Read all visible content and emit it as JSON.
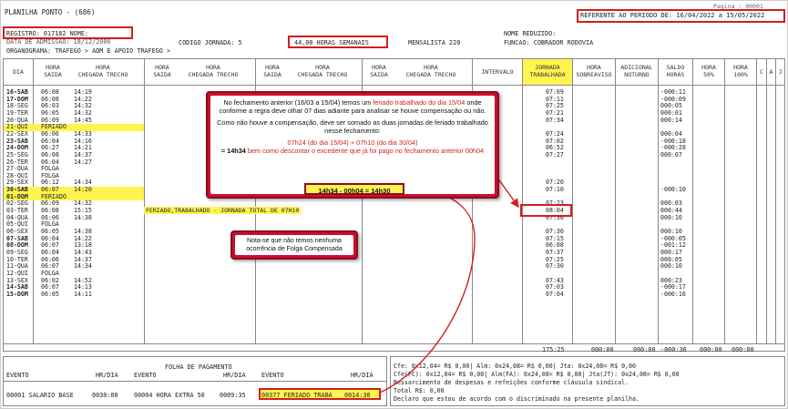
{
  "header": {
    "title": "PLANILHA PONTO - (686)",
    "pagina": "Pagina :  00001",
    "periodo": "REFERENTE AO PERIODO DE: 16/04/2022 a 15/05/2022",
    "registro": "REGISTRO: 017182   NOME:",
    "admissao": "DATA DE ADMISSAO:  18/12/2006",
    "codigo_jornada": "CODIGO JORNADA:  5",
    "horas_semanais": "44,00 HORAS SEMANAIS",
    "mensalista": "MENSALISTA     220",
    "nome_reduzido": "NOME REDUZIDO:",
    "funcao": "FUNCAO:  COBRADOR RODOVIA",
    "organograma": "ORGANOGRAMA: TRAFEGO > ADM E APOIO TRAFEGO >"
  },
  "columns": {
    "dia": "DIA",
    "hora_saida": "HORA\nSAIDA",
    "hora_chegada": "HORA\nCHEGADA TRECHO",
    "intervalo": "INTERVALO",
    "jornada": "JORNADA\nTRABALHADA",
    "sobreaviso": "HORA\nSOBREAVISO",
    "noturno": "ADICIONAL\nNOTURNO",
    "saldo": "SALDO\nHORAS",
    "h50": "HORA\n50%",
    "h100": "HORA\n100%",
    "c": "C",
    "a": "A",
    "j": "J"
  },
  "rows": [
    {
      "dia": "16-SAB",
      "s": "06:08",
      "c": "14:19",
      "jt": "07:09",
      "saldo": "-000:11",
      "hl": false
    },
    {
      "dia": "17-DOM",
      "s": "06:08",
      "c": "14:22",
      "jt": "07:11",
      "saldo": "-000:09",
      "hl": false
    },
    {
      "dia": "18-SEG",
      "s": "06:03",
      "c": "14:32",
      "jt": "07:25",
      "saldo": "000:05",
      "hl": false
    },
    {
      "dia": "19-TER",
      "s": "06:05",
      "c": "14:32",
      "jt": "07:21",
      "saldo": "000:01",
      "hl": false
    },
    {
      "dia": "20-QUA",
      "s": "06:09",
      "c": "14:45",
      "jt": "07:34",
      "saldo": "000:14",
      "hl": false
    },
    {
      "dia": "21-QUI",
      "s": "FERIADO",
      "c": "",
      "jt": "",
      "saldo": "",
      "hl": true
    },
    {
      "dia": "22-SEX",
      "s": "06:06",
      "c": "14:33",
      "jt": "07:24",
      "saldo": "000:04",
      "hl": false
    },
    {
      "dia": "23-SAB",
      "s": "06:04",
      "c": "14:16",
      "jt": "07:02",
      "saldo": "-000:18",
      "hl": false
    },
    {
      "dia": "24-DOM",
      "s": "06:27",
      "c": "14:21",
      "jt": "06:52",
      "saldo": "-000:28",
      "hl": false
    },
    {
      "dia": "25-SEG",
      "s": "06:08",
      "c": "14:37",
      "jt": "07:27",
      "saldo": "000:07",
      "hl": false
    },
    {
      "dia": "26-TER",
      "s": "06:04",
      "c": "14:27",
      "jt": "",
      "saldo": "",
      "hl": false
    },
    {
      "dia": "27-QUA",
      "s": "FOLGA",
      "c": "",
      "jt": "",
      "saldo": "",
      "hl": false
    },
    {
      "dia": "28-QUI",
      "s": "FOLGA",
      "c": "",
      "jt": "",
      "saldo": "",
      "hl": false
    },
    {
      "dia": "29-SEX",
      "s": "06:12",
      "c": "14:34",
      "jt": "07:20",
      "saldo": "",
      "hl": false
    },
    {
      "dia": "30-SAB",
      "s": "06:07",
      "c": "14:20",
      "jt": "07:10",
      "saldo": "-000:10",
      "hl": true
    },
    {
      "dia": "01-DOM",
      "s": "FERIADO",
      "c": "",
      "jt": "",
      "saldo": "",
      "hl": true
    },
    {
      "dia": "02-SEG",
      "s": "06:09",
      "c": "14:32",
      "jt": "07:23",
      "saldo": "000:03",
      "hl": false
    },
    {
      "dia": "03-TER",
      "s": "06:08",
      "c": "15:15",
      "jt": "08:04",
      "saldo": "000:44",
      "hl": false
    },
    {
      "dia": "04-QUA",
      "s": "06:06",
      "c": "14:38",
      "jt": "07:30",
      "saldo": "000:10",
      "hl": false
    },
    {
      "dia": "05-QUI",
      "s": "FOLGA",
      "c": "",
      "jt": "",
      "saldo": "",
      "hl": false
    },
    {
      "dia": "06-SEX",
      "s": "06:05",
      "c": "14:38",
      "jt": "07:30",
      "saldo": "000:10",
      "hl": false
    },
    {
      "dia": "07-SAB",
      "s": "06:04",
      "c": "14:22",
      "jt": "07:15",
      "saldo": "-000:05",
      "hl": false
    },
    {
      "dia": "08-DOM",
      "s": "06:07",
      "c": "13:18",
      "jt": "06:08",
      "saldo": "-001:12",
      "hl": false
    },
    {
      "dia": "09-SEG",
      "s": "06:04",
      "c": "14:43",
      "jt": "07:37",
      "saldo": "000:17",
      "hl": false
    },
    {
      "dia": "10-TER",
      "s": "06:06",
      "c": "14:37",
      "jt": "07:25",
      "saldo": "000:05",
      "hl": false
    },
    {
      "dia": "11-QUA",
      "s": "06:07",
      "c": "14:34",
      "jt": "07:30",
      "saldo": "000:10",
      "hl": false
    },
    {
      "dia": "12-QUI",
      "s": "FOLGA",
      "c": "",
      "jt": "",
      "saldo": "",
      "hl": false
    },
    {
      "dia": "13-SEX",
      "s": "06:02",
      "c": "14:52",
      "jt": "07:43",
      "saldo": "000:23",
      "hl": false
    },
    {
      "dia": "14-SAB",
      "s": "06:07",
      "c": "14:13",
      "jt": "07:03",
      "saldo": "-000:17",
      "hl": false
    },
    {
      "dia": "15-DOM",
      "s": "06:05",
      "c": "14:11",
      "jt": "07:04",
      "saldo": "-000:16",
      "hl": false
    }
  ],
  "feriado_note": "FERIADO,TRABALHADO - JORNADA TOTAL DE 07H10",
  "totals": {
    "jornada": "175:25",
    "sobreaviso": "000:00",
    "noturno": "000:00",
    "saldo": "-000:36",
    "h50": "000:00",
    "h100": "000:00"
  },
  "callout_main": {
    "p1a": "No fechamento anterior (16/03 a 15/04) temos um ",
    "p1b": "feriado trabalhado do dia 15/04",
    "p1c": " onde conforme a regra deve olhar 07 dias adiante para analisar se houve compensação ou não.",
    "p2": "Como não houve a compensação, deve ser somado as duas jornadas de feriado trabalhado nesse fechamento:",
    "p3": "07h24 (do dia 15/04) + 07h10 (do dia 30/04)",
    "p4a": "= 14h34 ",
    "p4b": "bem como descontar o excedente que já foi pago no fechamento anterior 00h04",
    "result": "14h34 - 00h04 = 14h30"
  },
  "callout_folga": "Nota-se que não temos nenhuma ocorrência de Folga Compensada",
  "footer": {
    "folha_title": "FOLHA DE PAGAMENTO",
    "col_evento": "EVENTO",
    "col_hrdia": "HR/DIA",
    "ev1": "00001 SALARIO BASE",
    "ev1_hr": "0030:00",
    "ev2": "00004 HORA EXTRA 50",
    "ev2_hr": "0009:35",
    "ev3": "00377 FERIADO TRABA",
    "ev3_hr": "0014:30",
    "r1": "Cfe: 0x12,04= R$ 0,00| Alm: 0x24,08= R$ 0,00| Jta: 0x24,08= R$ 0,00",
    "r2": "Cfe(FC): 0x12,04= R$ 0,00| Alm(FA): 0x24,08= R$ 0,00| Jta(JT): 0x24,08= R$ 0,00",
    "r3": "Ressarcimento de despesas e refeições conforme cláusula sindical.",
    "r4": "Total R$: 0,00",
    "r5": "Declaro que estou de acordo com o discriminado na presente planilha."
  }
}
